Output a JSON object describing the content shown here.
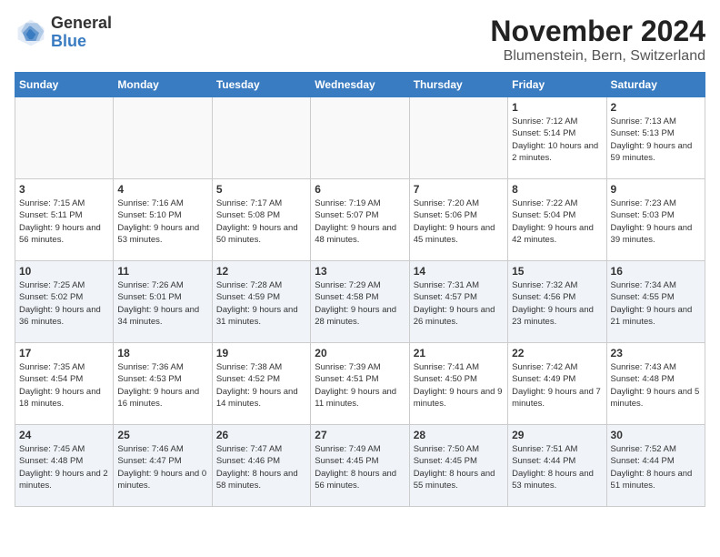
{
  "logo": {
    "general": "General",
    "blue": "Blue"
  },
  "header": {
    "month": "November 2024",
    "location": "Blumenstein, Bern, Switzerland"
  },
  "weekdays": [
    "Sunday",
    "Monday",
    "Tuesday",
    "Wednesday",
    "Thursday",
    "Friday",
    "Saturday"
  ],
  "weeks": [
    [
      {
        "day": "",
        "info": ""
      },
      {
        "day": "",
        "info": ""
      },
      {
        "day": "",
        "info": ""
      },
      {
        "day": "",
        "info": ""
      },
      {
        "day": "",
        "info": ""
      },
      {
        "day": "1",
        "info": "Sunrise: 7:12 AM\nSunset: 5:14 PM\nDaylight: 10 hours\nand 2 minutes."
      },
      {
        "day": "2",
        "info": "Sunrise: 7:13 AM\nSunset: 5:13 PM\nDaylight: 9 hours\nand 59 minutes."
      }
    ],
    [
      {
        "day": "3",
        "info": "Sunrise: 7:15 AM\nSunset: 5:11 PM\nDaylight: 9 hours\nand 56 minutes."
      },
      {
        "day": "4",
        "info": "Sunrise: 7:16 AM\nSunset: 5:10 PM\nDaylight: 9 hours\nand 53 minutes."
      },
      {
        "day": "5",
        "info": "Sunrise: 7:17 AM\nSunset: 5:08 PM\nDaylight: 9 hours\nand 50 minutes."
      },
      {
        "day": "6",
        "info": "Sunrise: 7:19 AM\nSunset: 5:07 PM\nDaylight: 9 hours\nand 48 minutes."
      },
      {
        "day": "7",
        "info": "Sunrise: 7:20 AM\nSunset: 5:06 PM\nDaylight: 9 hours\nand 45 minutes."
      },
      {
        "day": "8",
        "info": "Sunrise: 7:22 AM\nSunset: 5:04 PM\nDaylight: 9 hours\nand 42 minutes."
      },
      {
        "day": "9",
        "info": "Sunrise: 7:23 AM\nSunset: 5:03 PM\nDaylight: 9 hours\nand 39 minutes."
      }
    ],
    [
      {
        "day": "10",
        "info": "Sunrise: 7:25 AM\nSunset: 5:02 PM\nDaylight: 9 hours\nand 36 minutes."
      },
      {
        "day": "11",
        "info": "Sunrise: 7:26 AM\nSunset: 5:01 PM\nDaylight: 9 hours\nand 34 minutes."
      },
      {
        "day": "12",
        "info": "Sunrise: 7:28 AM\nSunset: 4:59 PM\nDaylight: 9 hours\nand 31 minutes."
      },
      {
        "day": "13",
        "info": "Sunrise: 7:29 AM\nSunset: 4:58 PM\nDaylight: 9 hours\nand 28 minutes."
      },
      {
        "day": "14",
        "info": "Sunrise: 7:31 AM\nSunset: 4:57 PM\nDaylight: 9 hours\nand 26 minutes."
      },
      {
        "day": "15",
        "info": "Sunrise: 7:32 AM\nSunset: 4:56 PM\nDaylight: 9 hours\nand 23 minutes."
      },
      {
        "day": "16",
        "info": "Sunrise: 7:34 AM\nSunset: 4:55 PM\nDaylight: 9 hours\nand 21 minutes."
      }
    ],
    [
      {
        "day": "17",
        "info": "Sunrise: 7:35 AM\nSunset: 4:54 PM\nDaylight: 9 hours\nand 18 minutes."
      },
      {
        "day": "18",
        "info": "Sunrise: 7:36 AM\nSunset: 4:53 PM\nDaylight: 9 hours\nand 16 minutes."
      },
      {
        "day": "19",
        "info": "Sunrise: 7:38 AM\nSunset: 4:52 PM\nDaylight: 9 hours\nand 14 minutes."
      },
      {
        "day": "20",
        "info": "Sunrise: 7:39 AM\nSunset: 4:51 PM\nDaylight: 9 hours\nand 11 minutes."
      },
      {
        "day": "21",
        "info": "Sunrise: 7:41 AM\nSunset: 4:50 PM\nDaylight: 9 hours\nand 9 minutes."
      },
      {
        "day": "22",
        "info": "Sunrise: 7:42 AM\nSunset: 4:49 PM\nDaylight: 9 hours\nand 7 minutes."
      },
      {
        "day": "23",
        "info": "Sunrise: 7:43 AM\nSunset: 4:48 PM\nDaylight: 9 hours\nand 5 minutes."
      }
    ],
    [
      {
        "day": "24",
        "info": "Sunrise: 7:45 AM\nSunset: 4:48 PM\nDaylight: 9 hours\nand 2 minutes."
      },
      {
        "day": "25",
        "info": "Sunrise: 7:46 AM\nSunset: 4:47 PM\nDaylight: 9 hours\nand 0 minutes."
      },
      {
        "day": "26",
        "info": "Sunrise: 7:47 AM\nSunset: 4:46 PM\nDaylight: 8 hours\nand 58 minutes."
      },
      {
        "day": "27",
        "info": "Sunrise: 7:49 AM\nSunset: 4:45 PM\nDaylight: 8 hours\nand 56 minutes."
      },
      {
        "day": "28",
        "info": "Sunrise: 7:50 AM\nSunset: 4:45 PM\nDaylight: 8 hours\nand 55 minutes."
      },
      {
        "day": "29",
        "info": "Sunrise: 7:51 AM\nSunset: 4:44 PM\nDaylight: 8 hours\nand 53 minutes."
      },
      {
        "day": "30",
        "info": "Sunrise: 7:52 AM\nSunset: 4:44 PM\nDaylight: 8 hours\nand 51 minutes."
      }
    ]
  ]
}
